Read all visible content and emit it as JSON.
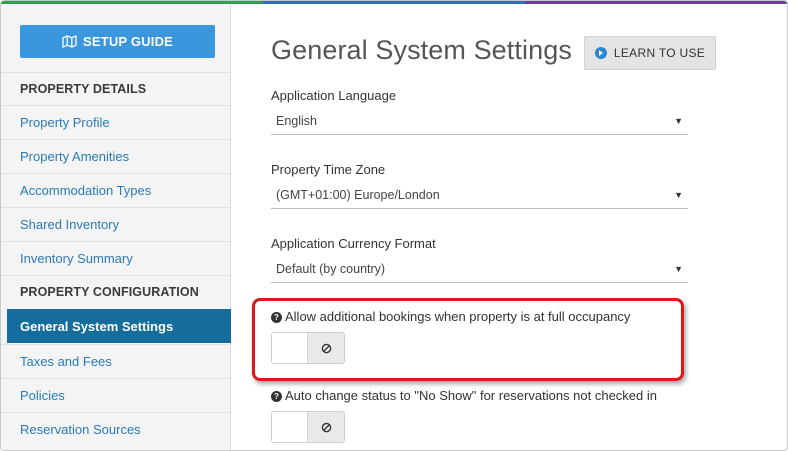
{
  "sidebar": {
    "setup_guide_label": "SETUP GUIDE",
    "section_property_details": "PROPERTY DETAILS",
    "items_details": [
      "Property Profile",
      "Property Amenities",
      "Accommodation Types",
      "Shared Inventory",
      "Inventory Summary"
    ],
    "section_property_configuration": "PROPERTY CONFIGURATION",
    "items_configuration": [
      "General System Settings",
      "Taxes and Fees",
      "Policies",
      "Reservation Sources"
    ],
    "active_item": "General System Settings"
  },
  "header": {
    "title": "General System Settings",
    "learn_button_label": "LEARN TO USE"
  },
  "settings": {
    "language_label": "Application Language",
    "language_value": "English",
    "timezone_label": "Property Time Zone",
    "timezone_value": "(GMT+01:00) Europe/London",
    "currency_label": "Application Currency Format",
    "currency_value": "Default (by country)",
    "full_occupancy_label": "Allow additional bookings when property is at full occupancy",
    "full_occupancy_enabled": false,
    "no_show_label": "Auto change status to \"No Show\" for reservations not checked in",
    "no_show_enabled": false
  },
  "colors": {
    "accent_blue": "#3a97de",
    "active_nav": "#156d9e",
    "link": "#2a7ab8",
    "highlight_red": "#e0161b"
  },
  "icons": {
    "setup_guide": "map-icon",
    "learn": "play-circle-icon",
    "select_caret": "caret-down-icon",
    "help": "question-circle-icon",
    "toggle_off": "ban-icon"
  }
}
